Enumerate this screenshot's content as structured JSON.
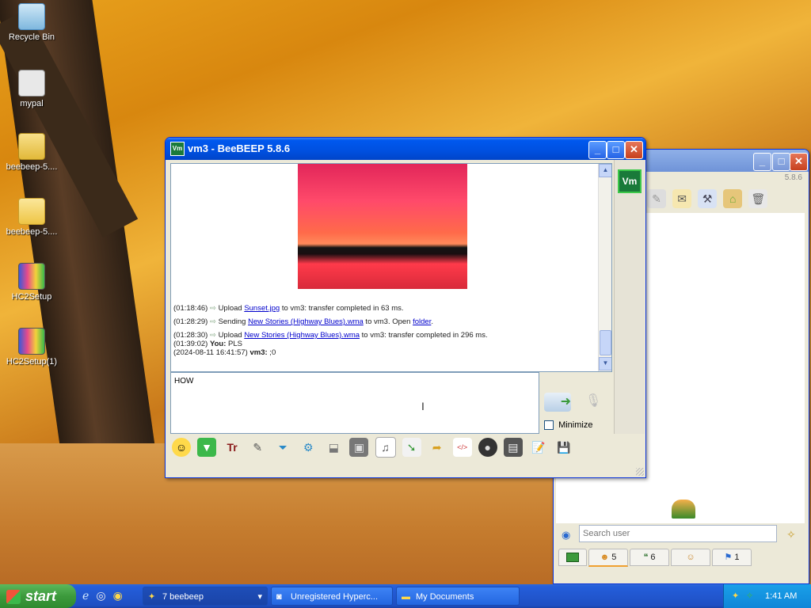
{
  "desktop": {
    "icons": [
      {
        "label": "Recycle Bin"
      },
      {
        "label": "mypal"
      },
      {
        "label": "beebeep-5...."
      },
      {
        "label": "beebeep-5...."
      },
      {
        "label": "HC2Setup"
      },
      {
        "label": "HC2Setup(1)"
      }
    ]
  },
  "chat_window": {
    "title": "vm3 - BeeBEEP 5.8.6",
    "app_badge": "Vm",
    "messages": [
      {
        "time": "(01:18:46)",
        "prefix": "Upload ",
        "link": "Sunset.jpg",
        "suffix": " to vm3: transfer completed in 63 ms."
      },
      {
        "time": "(01:28:29)",
        "prefix": "Sending ",
        "link": "New Stories (Highway Blues).wma",
        "suffix": " to vm3. Open ",
        "link2": "folder",
        "suffix2": "."
      },
      {
        "time": "(01:28:30)",
        "prefix": "Upload ",
        "link": "New Stories (Highway Blues).wma",
        "suffix": " to vm3: transfer completed in 296 ms."
      },
      {
        "time": "(01:39:02)",
        "sender": "You:",
        "text": " PLS"
      },
      {
        "time": "(2024-08-11 16:41:57)",
        "sender": "vm3:",
        "text": " ;0"
      }
    ],
    "input_value": "HOW",
    "minimize_label": "Minimize",
    "user_badge": "Vm"
  },
  "main_window": {
    "version": "5.8.6",
    "search_placeholder": "Search user",
    "tabs": [
      {
        "count": "5"
      },
      {
        "count": "6"
      },
      {
        "count": ""
      },
      {
        "count": "1"
      }
    ]
  },
  "taskbar": {
    "start_label": "start",
    "tasks": [
      {
        "label": "7 beebeep"
      },
      {
        "label": "Unregistered Hyperc..."
      },
      {
        "label": "My Documents"
      }
    ],
    "clock": "1:41 AM"
  }
}
